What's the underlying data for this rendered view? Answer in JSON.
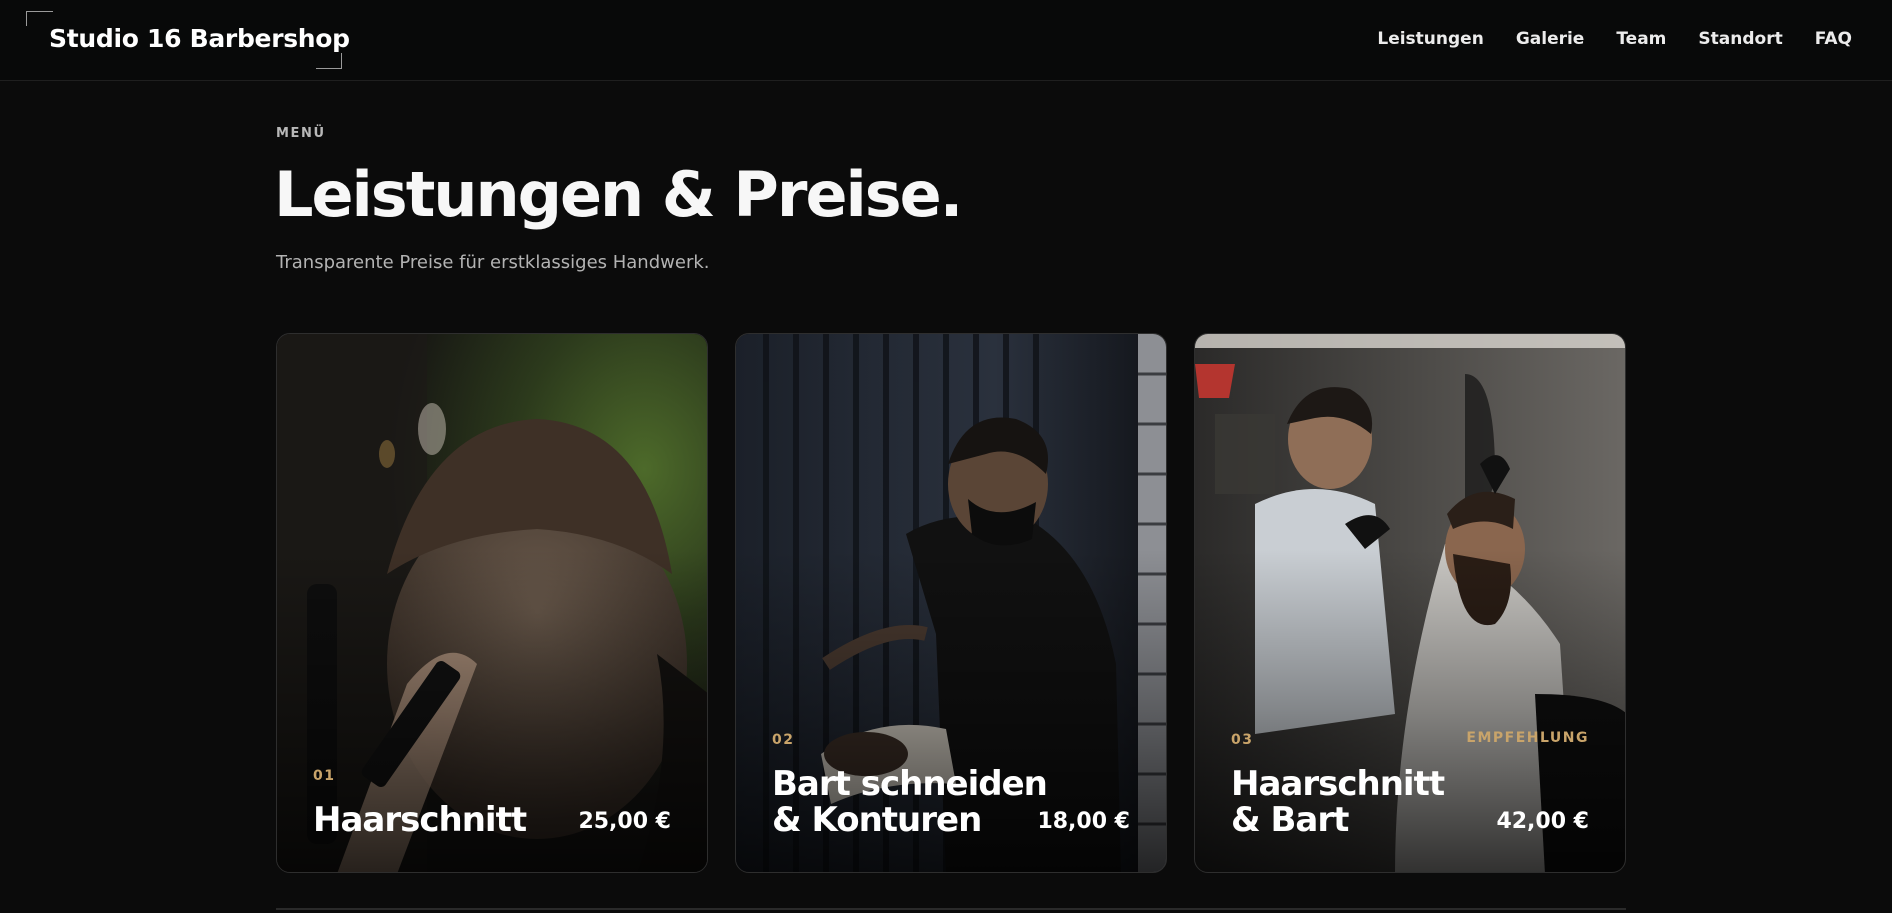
{
  "header": {
    "logo_text": "Studio 16 Barbershop",
    "nav": [
      "Leistungen",
      "Galerie",
      "Team",
      "Standort",
      "FAQ"
    ]
  },
  "section": {
    "eyebrow": "MENÜ",
    "title": "Leistungen & Preise.",
    "subtitle": "Transparente Preise für erstklassiges Handwerk."
  },
  "services": [
    {
      "number": "01",
      "name_line1": "Haarschnitt",
      "name_line2": "",
      "price": "25,00 €",
      "badge": ""
    },
    {
      "number": "02",
      "name_line1": "Bart schneiden",
      "name_line2": "& Konturen",
      "price": "18,00 €",
      "badge": ""
    },
    {
      "number": "03",
      "name_line1": "Haarschnitt",
      "name_line2": "& Bart",
      "price": "42,00 €",
      "badge": "EMPFEHLUNG"
    }
  ],
  "colors": {
    "background": "#0b0b0b",
    "accent": "#c9a46a",
    "text": "#f2f2f2"
  }
}
